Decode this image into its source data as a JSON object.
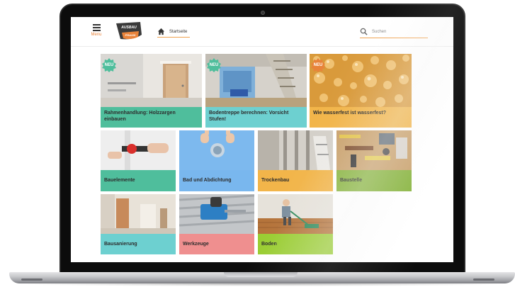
{
  "header": {
    "menu_label": "Menu",
    "home_label": "Startseite",
    "search_placeholder": "Suchen"
  },
  "logo": {
    "line1": "AUSBAU",
    "line2": "PRAXIS"
  },
  "badge_label": "NEU",
  "tiles": [
    {
      "caption": "Rahmenhandlung: Holzzargen einbauen",
      "color": "#4fbe9c",
      "new": true
    },
    {
      "caption": "Bodentreppe berechnen: Vorsicht Stufen!",
      "color": "#6dd0d0",
      "new": true
    },
    {
      "caption": "Wie wasserfest ist wasserfest?",
      "color": "#f2b54a",
      "new": true
    },
    {
      "caption": "Bauelemente",
      "color": "#4fbe9c",
      "new": false
    },
    {
      "caption": "Bad und Abdichtung",
      "color": "#79b7ee",
      "new": false
    },
    {
      "caption": "Trockenbau",
      "color": "#f2b54a",
      "new": false
    },
    {
      "caption": "Baustelle",
      "color": "#86b33b",
      "new": false
    },
    {
      "caption": "Bausanierung",
      "color": "#6dd0d0",
      "new": false
    },
    {
      "caption": "Werkzeuge",
      "color": "#ef8f8f",
      "new": false
    },
    {
      "caption": "Boden",
      "color": "#9acd33",
      "new": false
    }
  ],
  "colors": {
    "accent": "#e8833a",
    "badge": "#4fbe9c"
  }
}
